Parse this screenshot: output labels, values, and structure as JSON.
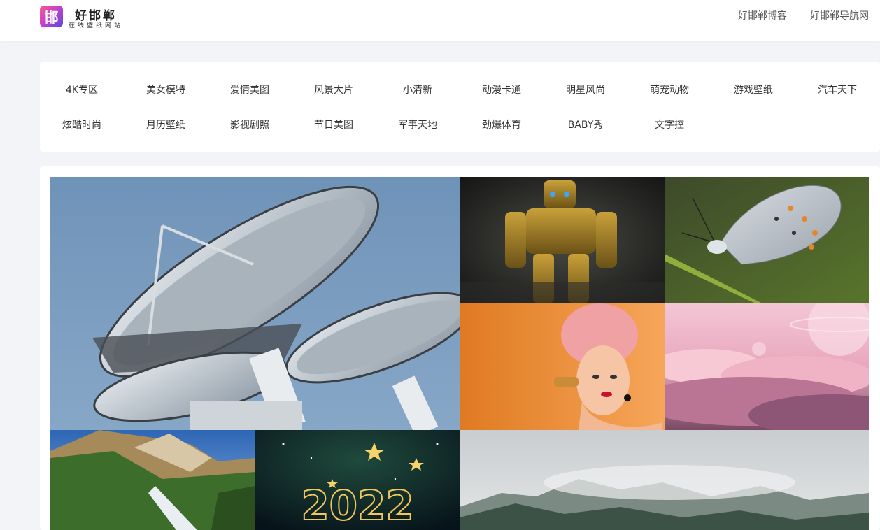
{
  "header": {
    "logo_mark": "邯",
    "logo_title": "好邯郸",
    "logo_subtitle": "在线壁纸网站",
    "nav": [
      "好邯郸博客",
      "好邯郸导航网"
    ]
  },
  "categories": {
    "row1": [
      "4K专区",
      "美女模特",
      "爱情美图",
      "风景大片",
      "小清新",
      "动漫卡通",
      "明星风尚",
      "萌宠动物",
      "游戏壁纸",
      "汽车天下"
    ],
    "row2": [
      "炫酷时尚",
      "月历壁纸",
      "影视剧照",
      "节日美图",
      "军事天地",
      "劲爆体育",
      "BABY秀",
      "文字控"
    ]
  },
  "gallery": {
    "tiles": [
      {
        "name": "satellite-dishes",
        "subject": "satellite-dish-image"
      },
      {
        "name": "robot",
        "subject": "robot-image"
      },
      {
        "name": "butterfly",
        "subject": "butterfly-image"
      },
      {
        "name": "pink-hair-woman",
        "subject": "woman-portrait-image"
      },
      {
        "name": "pink-clouds",
        "subject": "clouds-planet-image"
      },
      {
        "name": "mountain-waterfall",
        "subject": "mountain-landscape-image"
      },
      {
        "name": "new-year-2022",
        "subject": "2022-stars-image"
      },
      {
        "name": "misty-mountains",
        "subject": "foggy-mountain-image"
      }
    ],
    "new_year_text": "2022"
  },
  "colors": {
    "page_bg": "#f3f4f7",
    "panel_bg": "#ffffff",
    "text": "#333333"
  }
}
